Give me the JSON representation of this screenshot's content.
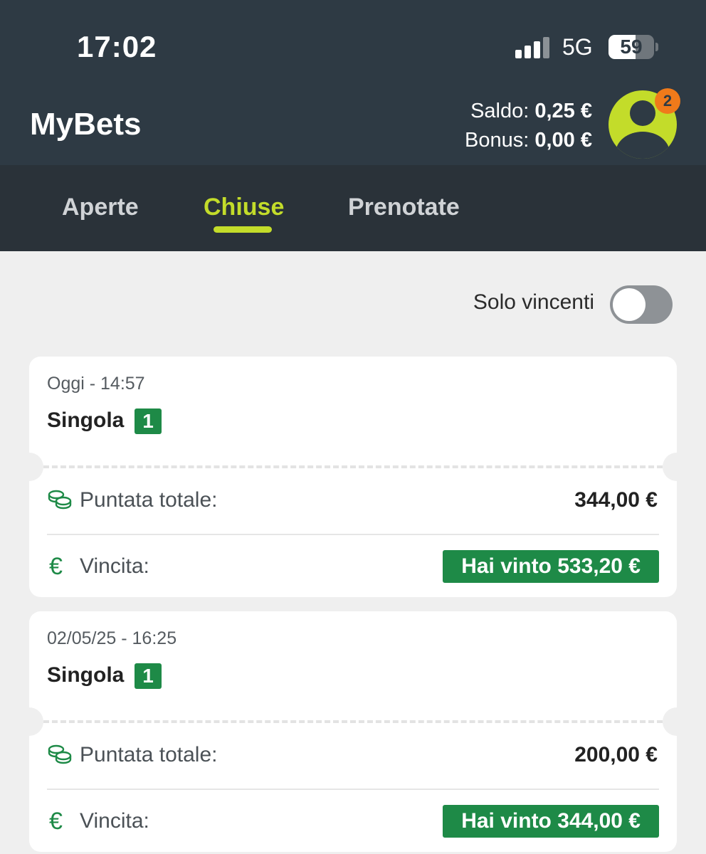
{
  "status_bar": {
    "time": "17:02",
    "network": "5G",
    "battery": "59",
    "battery_level": 0.59
  },
  "header": {
    "title": "MyBets",
    "saldo_label": "Saldo:",
    "saldo_value": "0,25 €",
    "bonus_label": "Bonus:",
    "bonus_value": "0,00 €",
    "notification_count": "2"
  },
  "tabs": [
    {
      "label": "Aperte",
      "active": false
    },
    {
      "label": "Chiuse",
      "active": true
    },
    {
      "label": "Prenotate",
      "active": false
    }
  ],
  "filter": {
    "label": "Solo vincenti",
    "on": false
  },
  "bets": [
    {
      "date": "Oggi - 14:57",
      "type": "Singola",
      "count": "1",
      "stake_label": "Puntata totale:",
      "stake_value": "344,00 €",
      "win_label": "Vincita:",
      "win_value": "Hai vinto 533,20 €"
    },
    {
      "date": "02/05/25 - 16:25",
      "type": "Singola",
      "count": "1",
      "stake_label": "Puntata totale:",
      "stake_value": "200,00 €",
      "win_label": "Vincita:",
      "win_value": "Hai vinto 344,00 €"
    }
  ],
  "icons": {
    "stake": "coins-stack-icon",
    "win": "euro-icon",
    "euro_glyph": "€"
  },
  "colors": {
    "header": "#2e3a44",
    "accent": "#c3dc2a",
    "win_green": "#1e8a47",
    "badge_orange": "#f07a1a"
  }
}
